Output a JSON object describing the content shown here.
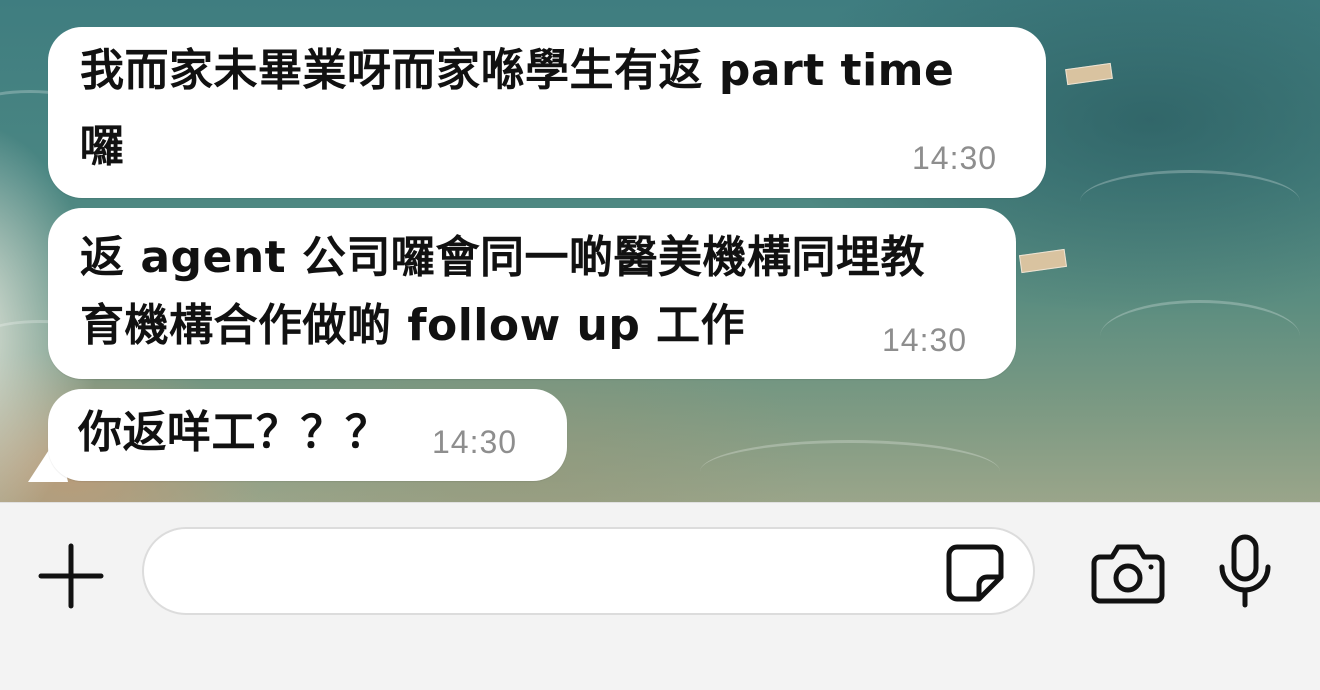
{
  "chat": {
    "messages": [
      {
        "lines": [
          "我而家未畢業呀而家喺學生有返 part time",
          "囉"
        ],
        "time": "14:30"
      },
      {
        "lines": [
          "返 agent 公司囉會同一啲醫美機構同埋教",
          "育機構合作做啲 follow up 工作"
        ],
        "time": "14:30"
      },
      {
        "lines": [
          "你返咩工？？？"
        ],
        "time": "14:30"
      }
    ]
  },
  "input_bar": {
    "message_value": "",
    "placeholder": "",
    "icons": [
      "plus-icon",
      "sticker-icon",
      "camera-icon",
      "microphone-icon"
    ]
  },
  "colors": {
    "bubble_bg": "#ffffff",
    "time_text": "#8e8e8e",
    "input_bar_bg": "#f3f3f3",
    "icon": "#111111"
  }
}
